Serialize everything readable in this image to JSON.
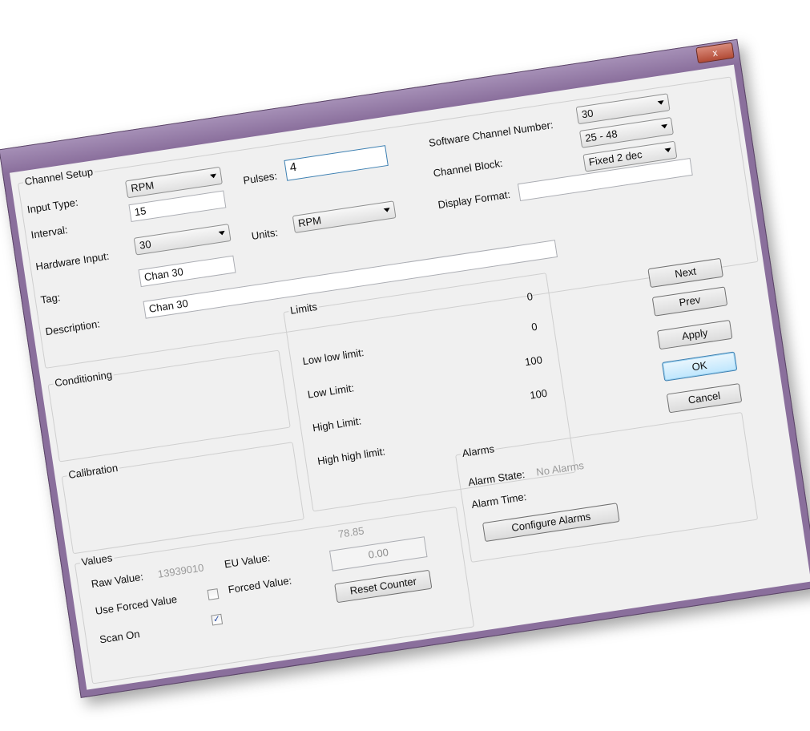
{
  "window": {
    "title": "Channel Setup",
    "close_label": "x"
  },
  "channel_setup": {
    "group_title": "Channel Setup",
    "input_type_label": "Input Type:",
    "input_type_value": "RPM",
    "interval_label": "Interval:",
    "interval_value": "15",
    "pulses_label": "Pulses:",
    "pulses_value": "4",
    "hardware_input_label": "Hardware Input:",
    "hardware_input_value": "30",
    "units_label": "Units:",
    "units_value": "RPM",
    "tag_label": "Tag:",
    "tag_value": "Chan 30",
    "description_label": "Description:",
    "description_value": "Chan 30",
    "software_channel_label": "Software Channel Number:",
    "software_channel_value": "30",
    "channel_block_label": "Channel Block:",
    "channel_block_value": "25 - 48",
    "display_format_label": "Display Format:",
    "display_format_value": "Fixed 2 dec",
    "display_format_text": ""
  },
  "conditioning": {
    "title": "Conditioning"
  },
  "calibration": {
    "title": "Calibration"
  },
  "limits": {
    "title": "Limits",
    "rows": [
      {
        "label": "Low low limit:",
        "value": "0"
      },
      {
        "label": "Low Limit:",
        "value": "0"
      },
      {
        "label": "High Limit:",
        "value": "100"
      },
      {
        "label": "High high limit:",
        "value": "100"
      }
    ]
  },
  "buttons": {
    "next": "Next",
    "prev": "Prev",
    "apply": "Apply",
    "ok": "OK",
    "cancel": "Cancel"
  },
  "values": {
    "title": "Values",
    "raw_value_label": "Raw Value:",
    "raw_value": "13939010",
    "eu_value_label": "EU Value:",
    "eu_value": "78.85",
    "forced_value_label": "Forced Value:",
    "forced_value": "0.00",
    "use_forced_label": "Use Forced Value",
    "use_forced_checked": false,
    "scan_on_label": "Scan On",
    "scan_on_checked": true,
    "reset_counter_label": "Reset Counter"
  },
  "alarms": {
    "title": "Alarms",
    "alarm_state_label": "Alarm State:",
    "alarm_state_value": "No Alarms",
    "alarm_time_label": "Alarm Time:",
    "alarm_time_value": "",
    "configure_label": "Configure Alarms"
  },
  "colors": {
    "frame": "#8a6f9c",
    "client_bg": "#f0f0f0",
    "default_button": "#bee6fd",
    "focus_border": "#3c7fb1"
  }
}
